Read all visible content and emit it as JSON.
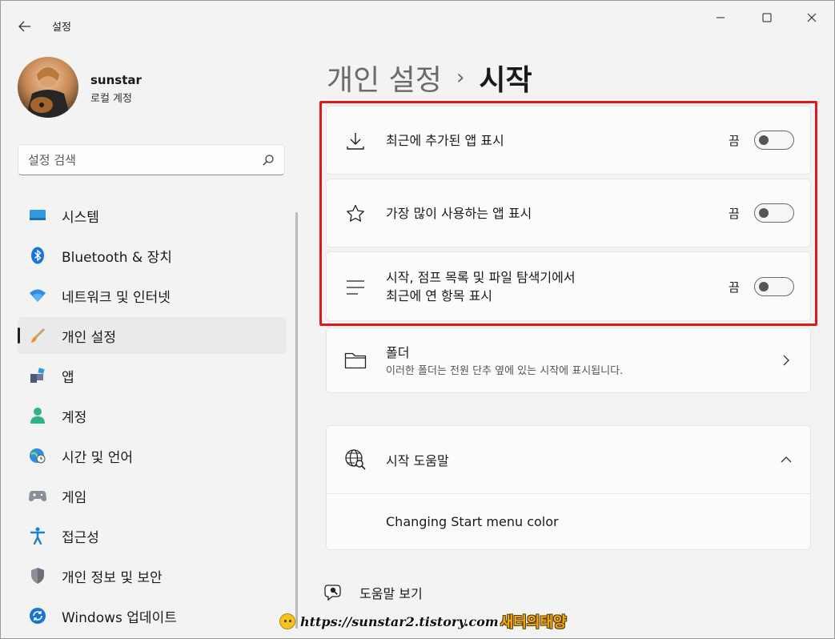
{
  "window": {
    "title": "설정",
    "controls": {
      "minimize_icon": "minimize-icon",
      "maximize_icon": "maximize-icon",
      "close_icon": "close-icon"
    }
  },
  "profile": {
    "name": "sunstar",
    "account_type": "로컬 계정"
  },
  "search": {
    "placeholder": "설정 검색"
  },
  "sidebar": {
    "items": [
      {
        "label": "시스템",
        "icon": "monitor-icon",
        "active": false
      },
      {
        "label": "Bluetooth & 장치",
        "icon": "bluetooth-icon",
        "active": false
      },
      {
        "label": "네트워크 및 인터넷",
        "icon": "wifi-icon",
        "active": false
      },
      {
        "label": "개인 설정",
        "icon": "paintbrush-icon",
        "active": true
      },
      {
        "label": "앱",
        "icon": "apps-icon",
        "active": false
      },
      {
        "label": "계정",
        "icon": "person-icon",
        "active": false
      },
      {
        "label": "시간 및 언어",
        "icon": "globe-clock-icon",
        "active": false
      },
      {
        "label": "게임",
        "icon": "gamepad-icon",
        "active": false
      },
      {
        "label": "접근성",
        "icon": "accessibility-icon",
        "active": false
      },
      {
        "label": "개인 정보 및 보안",
        "icon": "shield-icon",
        "active": false
      },
      {
        "label": "Windows 업데이트",
        "icon": "update-icon",
        "active": false
      }
    ]
  },
  "breadcrumb": {
    "parent": "개인 설정",
    "separator": "›",
    "current": "시작"
  },
  "settings": [
    {
      "label": "최근에 추가된 앱 표시",
      "state": "끔",
      "icon": "download-icon"
    },
    {
      "label": "가장 많이 사용하는 앱 표시",
      "state": "끔",
      "icon": "star-icon"
    },
    {
      "label_line1": "시작, 점프 목록 및 파일 탐색기에서",
      "label_line2": "최근에 연 항목 표시",
      "state": "끔",
      "icon": "list-icon"
    }
  ],
  "folders": {
    "title": "폴더",
    "subtitle": "이러한 폴더는 전원 단추 옆에 있는 시작에 표시됩니다.",
    "icon": "folder-icon"
  },
  "help": {
    "title": "시작 도움말",
    "link": "Changing Start menu color",
    "icon": "globe-search-icon"
  },
  "get_help": {
    "label": "도움말 보기",
    "icon": "help-chat-icon"
  },
  "watermark": {
    "url": "https://sunstar2.tistory.com",
    "name": "새터의태양"
  },
  "colors": {
    "highlight": "#e01818",
    "background": "#f3f3f3",
    "card": "#fbfbfb"
  }
}
